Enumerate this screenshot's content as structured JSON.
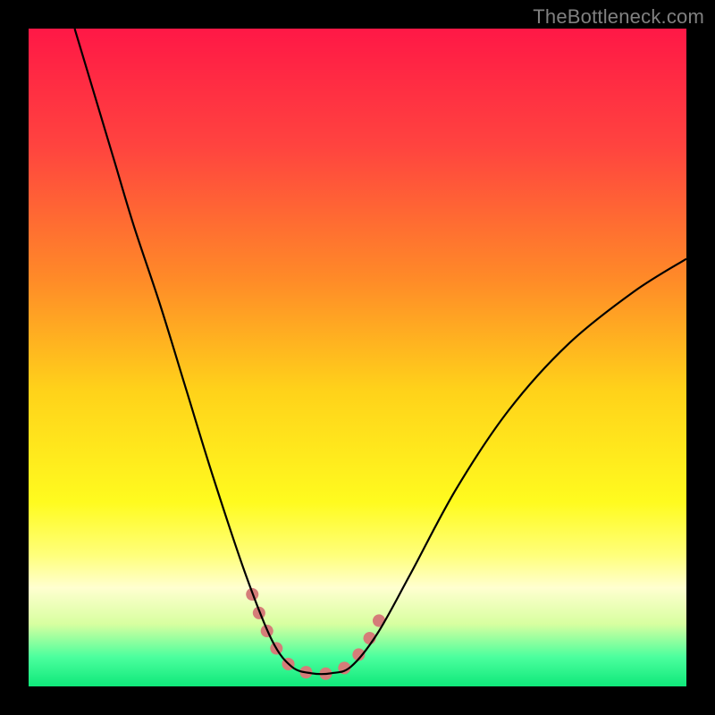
{
  "watermark": "TheBottleneck.com",
  "chart_data": {
    "type": "line",
    "title": "",
    "xlabel": "",
    "ylabel": "",
    "xlim": [
      0,
      100
    ],
    "ylim": [
      0,
      100
    ],
    "grid": false,
    "legend": false,
    "gradient_stops": [
      {
        "offset": 0.0,
        "color": "#ff1846"
      },
      {
        "offset": 0.18,
        "color": "#ff443f"
      },
      {
        "offset": 0.38,
        "color": "#ff8a28"
      },
      {
        "offset": 0.55,
        "color": "#ffd21a"
      },
      {
        "offset": 0.72,
        "color": "#fffb1f"
      },
      {
        "offset": 0.8,
        "color": "#ffff7a"
      },
      {
        "offset": 0.85,
        "color": "#ffffd0"
      },
      {
        "offset": 0.905,
        "color": "#d8ffa0"
      },
      {
        "offset": 0.955,
        "color": "#4cff9e"
      },
      {
        "offset": 1.0,
        "color": "#0fe87a"
      }
    ],
    "series": [
      {
        "name": "bottleneck-curve",
        "stroke": "#000000",
        "stroke_width": 2.2,
        "points": [
          {
            "x": 7,
            "y": 100
          },
          {
            "x": 10,
            "y": 90
          },
          {
            "x": 13,
            "y": 80
          },
          {
            "x": 16,
            "y": 70
          },
          {
            "x": 20,
            "y": 58
          },
          {
            "x": 24,
            "y": 45
          },
          {
            "x": 28,
            "y": 32
          },
          {
            "x": 33,
            "y": 17
          },
          {
            "x": 37,
            "y": 7
          },
          {
            "x": 40,
            "y": 3
          },
          {
            "x": 43,
            "y": 2
          },
          {
            "x": 46,
            "y": 2
          },
          {
            "x": 49,
            "y": 3
          },
          {
            "x": 53,
            "y": 8
          },
          {
            "x": 58,
            "y": 17
          },
          {
            "x": 65,
            "y": 30
          },
          {
            "x": 73,
            "y": 42
          },
          {
            "x": 82,
            "y": 52
          },
          {
            "x": 92,
            "y": 60
          },
          {
            "x": 100,
            "y": 65
          }
        ]
      },
      {
        "name": "valley-marker",
        "stroke": "#d57d79",
        "stroke_width": 14,
        "linecap": "round",
        "points": [
          {
            "x": 34.0,
            "y": 14.0
          },
          {
            "x": 35.5,
            "y": 10.0
          },
          {
            "x": 37.0,
            "y": 7.0
          },
          {
            "x": 38.5,
            "y": 4.5
          },
          {
            "x": 40.0,
            "y": 3.0
          },
          {
            "x": 42.0,
            "y": 2.2
          },
          {
            "x": 44.0,
            "y": 2.0
          },
          {
            "x": 46.0,
            "y": 2.0
          },
          {
            "x": 48.0,
            "y": 2.8
          },
          {
            "x": 49.5,
            "y": 4.0
          },
          {
            "x": 51.0,
            "y": 6.0
          },
          {
            "x": 52.5,
            "y": 8.5
          },
          {
            "x": 54.0,
            "y": 11.5
          }
        ]
      }
    ]
  }
}
